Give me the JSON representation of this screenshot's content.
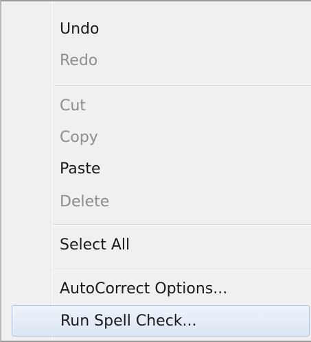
{
  "context_menu": {
    "items": [
      {
        "label": "Undo",
        "enabled": true
      },
      {
        "label": "Redo",
        "enabled": false
      },
      {
        "label": "Cut",
        "enabled": false
      },
      {
        "label": "Copy",
        "enabled": false
      },
      {
        "label": "Paste",
        "enabled": true
      },
      {
        "label": "Delete",
        "enabled": false
      },
      {
        "label": "Select All",
        "enabled": true
      },
      {
        "label": "AutoCorrect Options...",
        "enabled": true
      },
      {
        "label": "Run Spell Check...",
        "enabled": true,
        "highlighted": true
      }
    ]
  }
}
